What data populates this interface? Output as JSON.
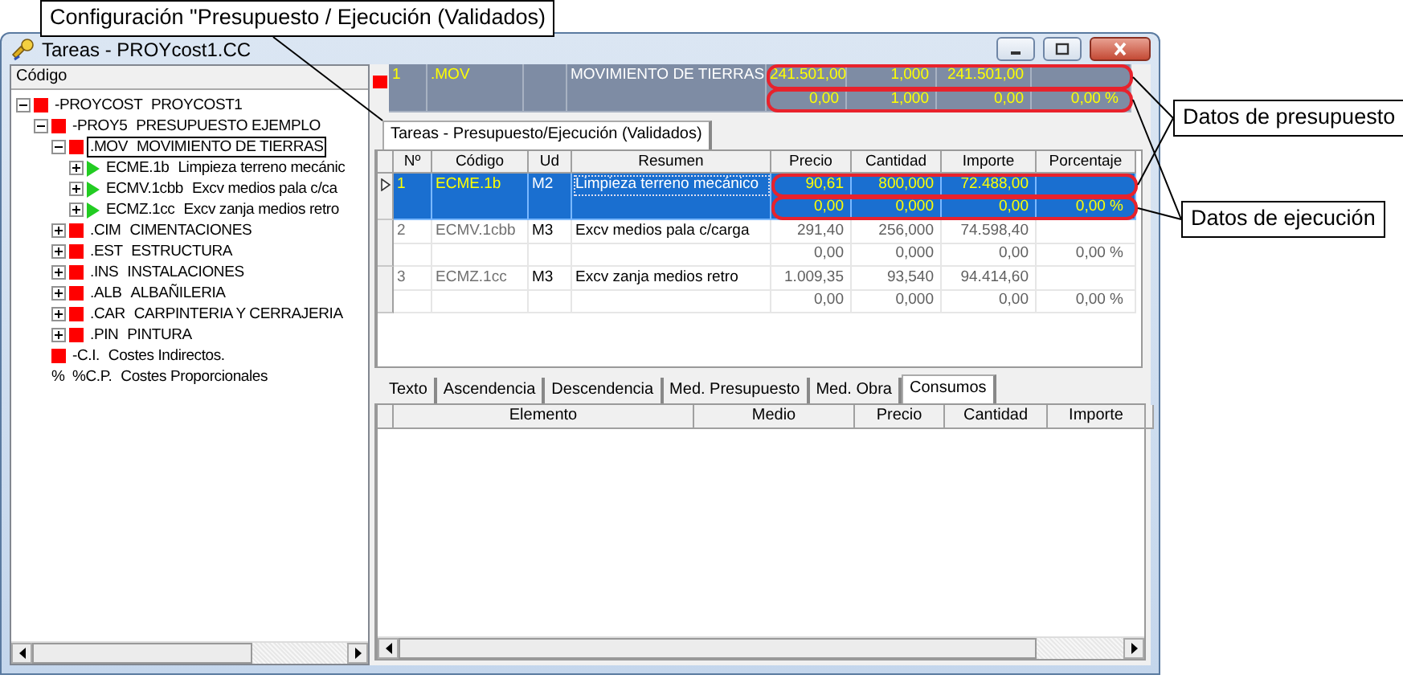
{
  "callouts": [
    {
      "text": "Configuración \"Presupuesto / Ejecución (Validados)"
    },
    {
      "text": "Datos de presupuesto"
    },
    {
      "text": "Datos de ejecución"
    }
  ],
  "window": {
    "title": "Tareas - PROYcost1.CC"
  },
  "tree": {
    "header": "Código",
    "items": [
      {
        "kind": "square",
        "code": "-PROYCOST",
        "name": "PROYCOST1",
        "expanded": true,
        "selected": false,
        "children": [
          {
            "kind": "square",
            "code": "-PROY5",
            "name": "PRESUPUESTO EJEMPLO",
            "expanded": true,
            "selected": false,
            "children": [
              {
                "kind": "square",
                "code": ".MOV",
                "name": "MOVIMIENTO DE TIERRAS",
                "expanded": true,
                "selected": true,
                "children": [
                  {
                    "kind": "triangle",
                    "code": "ECME.1b",
                    "name": "Limpieza terreno mecánic",
                    "expanded": false,
                    "selected": false
                  },
                  {
                    "kind": "triangle",
                    "code": "ECMV.1cbb",
                    "name": "Excv medios pala c/ca",
                    "expanded": false,
                    "selected": false
                  },
                  {
                    "kind": "triangle",
                    "code": "ECMZ.1cc",
                    "name": "Excv zanja medios retro",
                    "expanded": false,
                    "selected": false
                  }
                ]
              },
              {
                "kind": "square",
                "code": ".CIM",
                "name": "CIMENTACIONES",
                "expanded": false,
                "selected": false
              },
              {
                "kind": "square",
                "code": ".EST",
                "name": "ESTRUCTURA",
                "expanded": false,
                "selected": false
              },
              {
                "kind": "square",
                "code": ".INS",
                "name": "INSTALACIONES",
                "expanded": false,
                "selected": false
              },
              {
                "kind": "square",
                "code": ".ALB",
                "name": "ALBAÑILERIA",
                "expanded": false,
                "selected": false
              },
              {
                "kind": "square",
                "code": ".CAR",
                "name": "CARPINTERIA Y CERRAJERIA",
                "expanded": false,
                "selected": false
              },
              {
                "kind": "square",
                "code": ".PIN",
                "name": "PINTURA",
                "expanded": false,
                "selected": false
              }
            ]
          },
          {
            "kind": "square",
            "code": "-C.I.",
            "name": "Costes Indirectos.",
            "selected": false
          },
          {
            "kind": "percent",
            "symbol": "%",
            "code": "%C.P.",
            "name": "Costes Proporcionales",
            "selected": false
          }
        ]
      }
    ]
  },
  "summary": {
    "rows": [
      {
        "highlighted": true,
        "cells": [
          "1",
          ".MOV",
          null,
          "MOVIMIENTO DE TIERRAS",
          "241.501,00",
          "1,000",
          "241.501,00",
          null
        ]
      },
      {
        "highlighted": true,
        "cells": [
          null,
          null,
          null,
          null,
          "0,00",
          "1,000",
          "0,00",
          "0,00 %"
        ]
      }
    ]
  },
  "grid": {
    "tab": {
      "label": "Tareas - Presupuesto/Ejecución (Validados)",
      "selected": true
    },
    "columns": [
      "Nº",
      "Código",
      "Ud",
      "Resumen",
      "Precio",
      "Cantidad",
      "Importe",
      "Porcentaje"
    ],
    "records": [
      {
        "selected": true,
        "budget": {
          "highlighted": true,
          "cells": [
            "1",
            "ECME.1b",
            "M2",
            "Limpieza terreno mecánico",
            "90,61",
            "800,000",
            "72.488,00",
            null
          ]
        },
        "execution": {
          "highlighted": true,
          "cells": [
            null,
            null,
            null,
            null,
            "0,00",
            "0,000",
            "0,00",
            "0,00 %"
          ]
        }
      },
      {
        "selected": false,
        "budget": {
          "highlighted": false,
          "cells": [
            "2",
            "ECMV.1cbb",
            "M3",
            "Excv medios pala c/carga",
            "291,40",
            "256,000",
            "74.598,40",
            null
          ]
        },
        "execution": {
          "highlighted": false,
          "cells": [
            null,
            null,
            null,
            null,
            "0,00",
            "0,000",
            "0,00",
            "0,00 %"
          ]
        }
      },
      {
        "selected": false,
        "budget": {
          "highlighted": false,
          "cells": [
            "3",
            "ECMZ.1cc",
            "M3",
            "Excv zanja medios retro",
            "1.009,35",
            "93,540",
            "94.414,60",
            null
          ]
        },
        "execution": {
          "highlighted": false,
          "cells": [
            null,
            null,
            null,
            null,
            "0,00",
            "0,000",
            "0,00",
            "0,00 %"
          ]
        }
      }
    ]
  },
  "detail": {
    "tabs": [
      {
        "label": "Texto",
        "selected": false
      },
      {
        "label": "Ascendencia",
        "selected": false
      },
      {
        "label": "Descendencia",
        "selected": false
      },
      {
        "label": "Med. Presupuesto",
        "selected": false
      },
      {
        "label": "Med. Obra",
        "selected": false
      },
      {
        "label": "Consumos",
        "selected": true
      }
    ],
    "columns": [
      "Elemento",
      "Medio",
      "Precio",
      "Cantidad",
      "Importe"
    ]
  }
}
